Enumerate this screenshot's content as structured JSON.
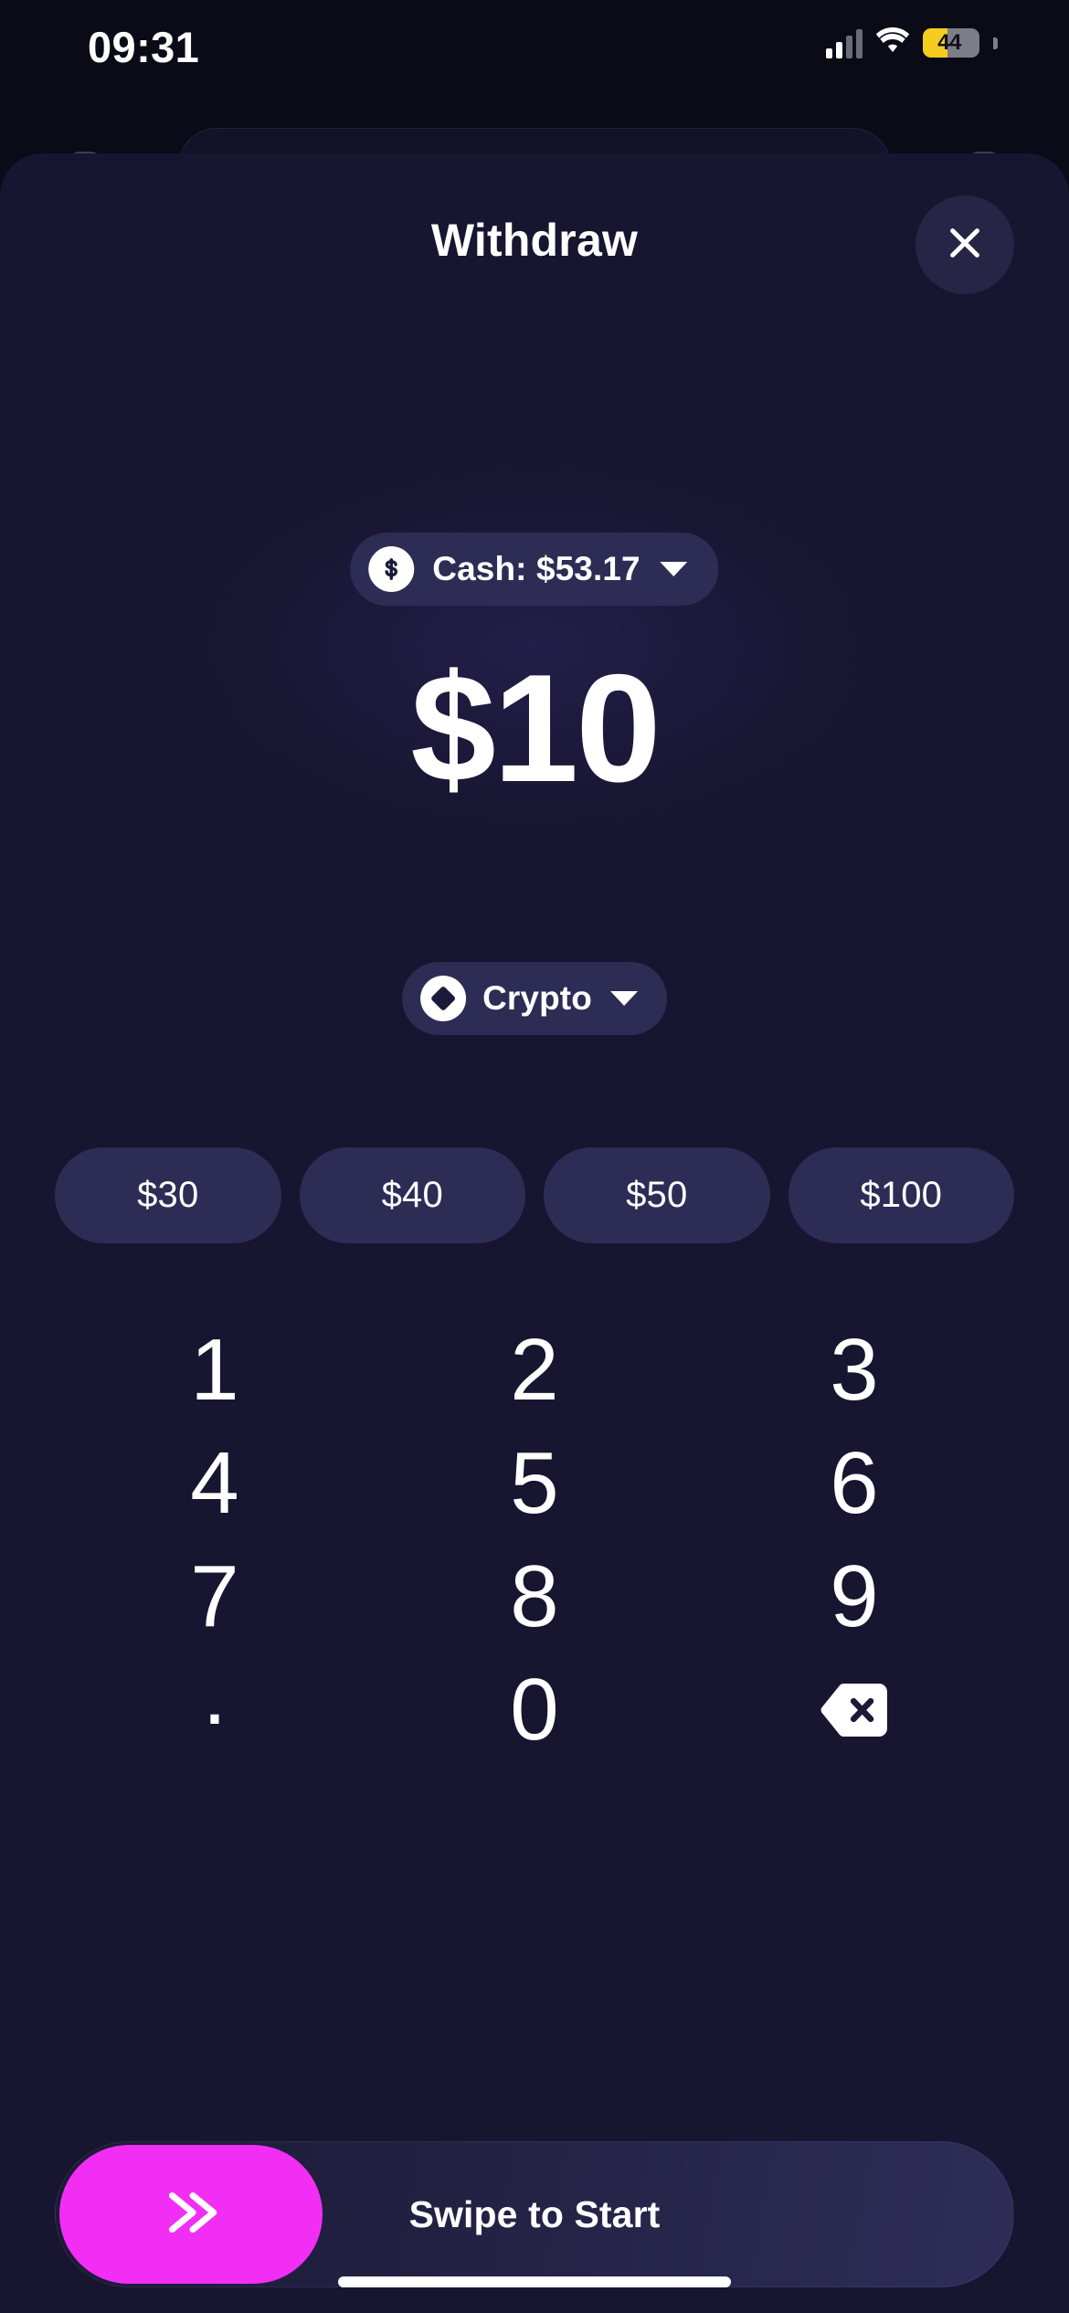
{
  "status_bar": {
    "time": "09:31",
    "battery_percent": "44",
    "battery_level": 44,
    "signal_icon": "cellular-signal-icon",
    "wifi_icon": "wifi-icon",
    "battery_icon": "battery-low-power-icon",
    "battery_color": "#f5cd1e"
  },
  "sheet": {
    "title": "Withdraw",
    "close_icon": "close-icon"
  },
  "account_selector": {
    "label": "Cash: $53.17",
    "icon": "dollar-coin-icon",
    "chevron_icon": "chevron-down-icon"
  },
  "amount_display": {
    "value": "$10"
  },
  "asset_selector": {
    "label": "Crypto",
    "icon": "crypto-diamond-icon",
    "chevron_icon": "chevron-down-icon"
  },
  "quick_amounts": [
    {
      "label": "$30"
    },
    {
      "label": "$40"
    },
    {
      "label": "$50"
    },
    {
      "label": "$100"
    }
  ],
  "keypad": [
    {
      "key": "1",
      "type": "digit"
    },
    {
      "key": "2",
      "type": "digit"
    },
    {
      "key": "3",
      "type": "digit"
    },
    {
      "key": "4",
      "type": "digit"
    },
    {
      "key": "5",
      "type": "digit"
    },
    {
      "key": "6",
      "type": "digit"
    },
    {
      "key": "7",
      "type": "digit"
    },
    {
      "key": "8",
      "type": "digit"
    },
    {
      "key": "9",
      "type": "digit"
    },
    {
      "key": ".",
      "type": "decimal"
    },
    {
      "key": "0",
      "type": "digit"
    },
    {
      "key": "backspace-icon",
      "type": "backspace"
    }
  ],
  "swipe_action": {
    "label": "Swipe to Start",
    "thumb_icon": "double-chevron-right-icon",
    "thumb_color": "#f22ef5"
  },
  "theme": {
    "background": "#0b0a17",
    "sheet_background": "#171530",
    "pill_background": "#2d2c55",
    "accent": "#f22ef5",
    "text_primary": "#ffffff"
  }
}
